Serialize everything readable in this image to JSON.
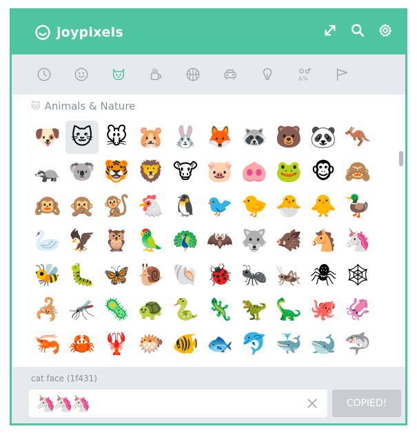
{
  "app": {
    "brand_name": "joypixels",
    "accent_color": "#4fc59f"
  },
  "header": {
    "icons": [
      "expand-icon",
      "search-icon",
      "gear-icon"
    ]
  },
  "tabs": [
    {
      "name": "recent",
      "icon": "clock-icon",
      "active": false
    },
    {
      "name": "people",
      "icon": "smiley-icon",
      "active": false
    },
    {
      "name": "nature",
      "icon": "cat-icon",
      "active": true
    },
    {
      "name": "food",
      "icon": "cup-icon",
      "active": false
    },
    {
      "name": "activity",
      "icon": "ball-icon",
      "active": false
    },
    {
      "name": "travel",
      "icon": "car-icon",
      "active": false
    },
    {
      "name": "objects",
      "icon": "bulb-icon",
      "active": false
    },
    {
      "name": "symbols",
      "icon": "symbols-icon",
      "active": false
    },
    {
      "name": "flags",
      "icon": "flag-icon",
      "active": false
    }
  ],
  "section": {
    "icon": "🐱",
    "title": "Animals & Nature"
  },
  "emojis": [
    "🐶",
    "🐱",
    "🐭",
    "🐹",
    "🐰",
    "🦊",
    "🦝",
    "🐻",
    "🐼",
    "🦘",
    "🦡",
    "🐨",
    "🐯",
    "🦁",
    "🐮",
    "🐷",
    "🐽",
    "🐸",
    "🐵",
    "🙈",
    "🙉",
    "🙊",
    "🐒",
    "🐔",
    "🐧",
    "🐦",
    "🐤",
    "🐣",
    "🐥",
    "🦆",
    "🦢",
    "🦅",
    "🦉",
    "🦜",
    "🦚",
    "🦇",
    "🐺",
    "🐗",
    "🐴",
    "🦄",
    "🐝",
    "🐛",
    "🦋",
    "🐌",
    "🐚",
    "🐞",
    "🐜",
    "🦗",
    "🕷",
    "🕸",
    "🦂",
    "🦟",
    "🦠",
    "🐢",
    "🐍",
    "🦎",
    "🦖",
    "🦕",
    "🐙",
    "🦑",
    "🦐",
    "🦀",
    "🦞",
    "🐡",
    "🐠",
    "🐟",
    "🐬",
    "🐳",
    "🐋",
    "🦈"
  ],
  "selected_index": 1,
  "footer": {
    "preview_name": "cat face (1f431)",
    "copy_value": "🦄🦄🦄",
    "copied_label": "COPIED!"
  }
}
